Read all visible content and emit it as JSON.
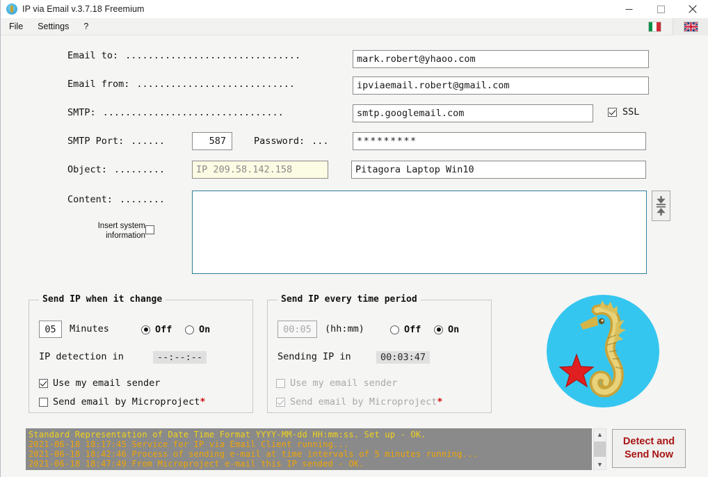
{
  "window": {
    "title": "IP via Email v.3.7.18 Freemium",
    "minimize": "minimize-button",
    "maximize": "maximize-button",
    "close": "close-button"
  },
  "menu": {
    "items": [
      "File",
      "Settings",
      "?"
    ],
    "flags": [
      {
        "name": "italian-flag",
        "selected": false
      },
      {
        "name": "uk-flag",
        "selected": true
      }
    ]
  },
  "form": {
    "email_to": {
      "label": "Email to:",
      "leader": "...............................",
      "value": "mark.robert@yhaoo.com"
    },
    "email_from": {
      "label": "Email from:",
      "leader": "............................",
      "value": "ipviaemail.robert@gmail.com"
    },
    "smtp": {
      "label": "SMTP:",
      "leader": "................................",
      "value": "smtp.googlemail.com",
      "ssl_label": "SSL",
      "ssl_checked": true
    },
    "smtp_port": {
      "label": "SMTP Port:",
      "leader": "......",
      "value": "587"
    },
    "password": {
      "label": "Password:",
      "leader": "...",
      "value": "*********"
    },
    "object": {
      "label": "Object:",
      "leader": ".........",
      "ip_value": "IP 209.58.142.158",
      "subject_value": "Pitagora Laptop Win10"
    },
    "content": {
      "label": "Content:",
      "leader": "........",
      "value": "",
      "insert_system_line1": "Insert system",
      "insert_system_line2": "information",
      "insert_system_checked": false,
      "collapse_icon": "collapse-expand-icon"
    }
  },
  "group_change": {
    "title": "Send IP when it change",
    "minutes_value": "05",
    "minutes_label": "Minutes",
    "off_label": "Off",
    "on_label": "On",
    "radio_selected": "Off",
    "detection_label": "IP detection in",
    "detection_value": "--:--:--",
    "use_sender_label": "Use my email sender",
    "use_sender_checked": true,
    "microproject_label": "Send email by Microproject",
    "microproject_asterisk": "*",
    "microproject_checked": false
  },
  "group_period": {
    "title": "Send IP every time period",
    "period_value": "00:05",
    "period_format": "(hh:mm)",
    "off_label": "Off",
    "on_label": "On",
    "radio_selected": "On",
    "sending_label": "Sending IP in",
    "sending_value": "00:03:47",
    "use_sender_label": "Use my email sender",
    "use_sender_checked": false,
    "microproject_label": "Send email by Microproject",
    "microproject_asterisk": "*",
    "microproject_checked": true
  },
  "logo": {
    "name": "seahorse-logo",
    "disc_color": "#35c6ef",
    "star_color": "#e02020"
  },
  "log": {
    "lines": [
      "Standard Representation of Date Time Format YYYY-MM-dd HH:mm:ss. Set up - OK.",
      "2021-06-18 18:17:45 Service for IP via Email Client running...",
      "2021-06-18 18:42:46 Process of sending e-mail at time intervals of 5 minutes running...",
      "2021-06-18 18:47:49 From Microproject e-mail this IP sended - OK."
    ]
  },
  "detect_button": {
    "line1": "Detect and",
    "line2": "Send Now"
  },
  "colors": {
    "accent": "#35c6ef",
    "log_text": "#f0a505",
    "button_text": "#a81414",
    "border": "#8a8a8a"
  }
}
